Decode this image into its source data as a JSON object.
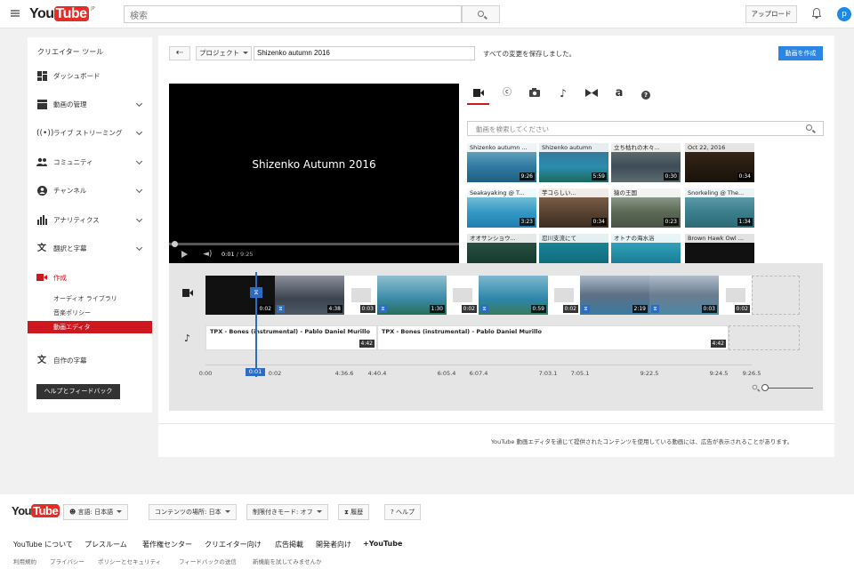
{
  "header": {
    "logo_you": "You",
    "logo_tube": "Tube",
    "logo_region": "JP",
    "search_placeholder": "検索",
    "upload_label": "アップロード",
    "avatar_letter": "p"
  },
  "sidebar": {
    "title": "クリエイター ツール",
    "items": [
      {
        "label": "ダッシュボード",
        "icon": "dashboard-icon"
      },
      {
        "label": "動画の管理",
        "icon": "video-manager-icon"
      },
      {
        "label": "ライブ ストリーミング",
        "icon": "live-icon"
      },
      {
        "label": "コミュニティ",
        "icon": "community-icon"
      },
      {
        "label": "チャンネル",
        "icon": "channel-icon"
      },
      {
        "label": "アナリティクス",
        "icon": "analytics-icon"
      },
      {
        "label": "翻訳と字幕",
        "icon": "translate-icon"
      },
      {
        "label": "作成",
        "icon": "create-icon"
      }
    ],
    "sub_items": [
      "オーディオ ライブラリ",
      "音楽ポリシー",
      "動画エディタ"
    ],
    "own_subtitles": "自作の字幕",
    "help_button": "ヘルプとフィードバック"
  },
  "editor": {
    "project_dropdown": "プロジェクト",
    "project_title": "Shizenko autumn 2016",
    "save_status": "すべての変更を保存しました。",
    "create_button": "動画を作成",
    "player_title": "Shizenko Autumn 2016",
    "time_current": "0:01",
    "time_total": "/ 9:25",
    "library_search_placeholder": "動画を検索してください",
    "thumbnails": [
      {
        "title": "Shizenko autumn ...",
        "duration": "9:26"
      },
      {
        "title": "Shizenko autumn",
        "duration": "5:59"
      },
      {
        "title": "立ち枯れの木々...",
        "duration": "0:30"
      },
      {
        "title": "Oct 22, 2016",
        "duration": "0:34"
      },
      {
        "title": "Seakayaking @ T...",
        "duration": "3:23"
      },
      {
        "title": "芋コらしい...",
        "duration": "0:34"
      },
      {
        "title": "猿の王国",
        "duration": "0:23"
      },
      {
        "title": "Snorkeling @ The...",
        "duration": "1:34"
      },
      {
        "title": "オオサンショウ...",
        "duration": ""
      },
      {
        "title": "忍川支流にて",
        "duration": ""
      },
      {
        "title": "オトナの海水浴",
        "duration": ""
      },
      {
        "title": "Brown Hawk Owl ...",
        "duration": ""
      }
    ],
    "clips": [
      {
        "duration": "0:02"
      },
      {
        "duration": "4:38"
      },
      {
        "duration": "0:03"
      },
      {
        "duration": "1:30"
      },
      {
        "duration": "0:02"
      },
      {
        "duration": "0:59"
      },
      {
        "duration": "0:02"
      },
      {
        "duration": "2:19"
      },
      {
        "duration": "0:03"
      },
      {
        "duration": "0:02"
      }
    ],
    "audio": [
      {
        "title": "TPX - Bones (instrumental) - Pablo Daniel Murillo",
        "duration": "4:42"
      },
      {
        "title": "TPX - Bones (instrumental) - Pablo Daniel Murillo",
        "duration": "4:42"
      }
    ],
    "ticks": [
      "0:00",
      "0:01",
      "0:02",
      "4:36.6",
      "4:40.4",
      "6:05.4",
      "6:07.4",
      "7:03.1",
      "7:05.1",
      "9:22.5",
      "9:24.5",
      "9:26.5"
    ],
    "playhead_label": "0:01",
    "notice": "YouTube 動画エディタを通じて提供されたコンテンツを使用している動画には、広告が表示されることがあります。"
  },
  "footer": {
    "language": "言語: 日本語",
    "location": "コンテンツの場所: 日本",
    "restricted": "制限付きモード: オフ",
    "history": "履歴",
    "help": "ヘルプ",
    "links": [
      "YouTube について",
      "プレスルーム",
      "著作権センター",
      "クリエイター向け",
      "広告掲載",
      "開発者向け",
      "+YouTube"
    ],
    "links2": [
      "利用規約",
      "プライバシー",
      "ポリシーとセキュリティ",
      "フィードバックの送信",
      "新機能を試してみませんか"
    ]
  }
}
